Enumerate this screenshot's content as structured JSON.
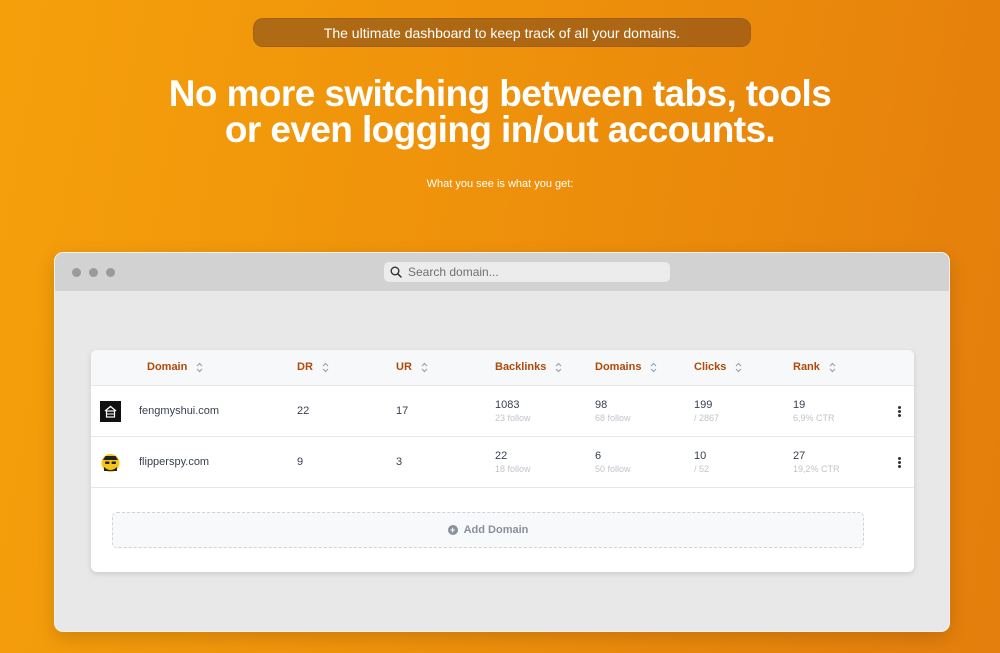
{
  "banner": {
    "text": "The ultimate dashboard to keep track of all your domains."
  },
  "hero": {
    "line1": "No more switching between tabs, tools",
    "line2": "or even logging in/out accounts.",
    "subtitle": "What you see is what you get:"
  },
  "browser": {
    "search_placeholder": "Search domain...",
    "window_dots": [
      "close-dot",
      "minimize-dot",
      "maximize-dot"
    ]
  },
  "table": {
    "columns": [
      "Domain",
      "DR",
      "UR",
      "Backlinks",
      "Domains",
      "Clicks",
      "Rank"
    ],
    "rows": [
      {
        "domain": "fengmyshui.com",
        "logo": "house-logo",
        "dr": "22",
        "ur": "17",
        "backlinks": "1083",
        "backlinks_sub": "23 follow",
        "domains": "98",
        "domains_sub": "68 follow",
        "clicks": "199",
        "clicks_sub": "/ 2867",
        "rank": "19",
        "rank_sub": "6,9% CTR"
      },
      {
        "domain": "flipperspy.com",
        "logo": "spy-face-logo",
        "dr": "9",
        "ur": "3",
        "backlinks": "22",
        "backlinks_sub": "18 follow",
        "domains": "6",
        "domains_sub": "50 follow",
        "clicks": "10",
        "clicks_sub": "/ 52",
        "rank": "27",
        "rank_sub": "19,2% CTR"
      }
    ],
    "add_label": "Add Domain"
  },
  "colors": {
    "accent_header": "#b04a0a",
    "background_start": "#f5a00b",
    "background_end": "#e47e0c"
  }
}
